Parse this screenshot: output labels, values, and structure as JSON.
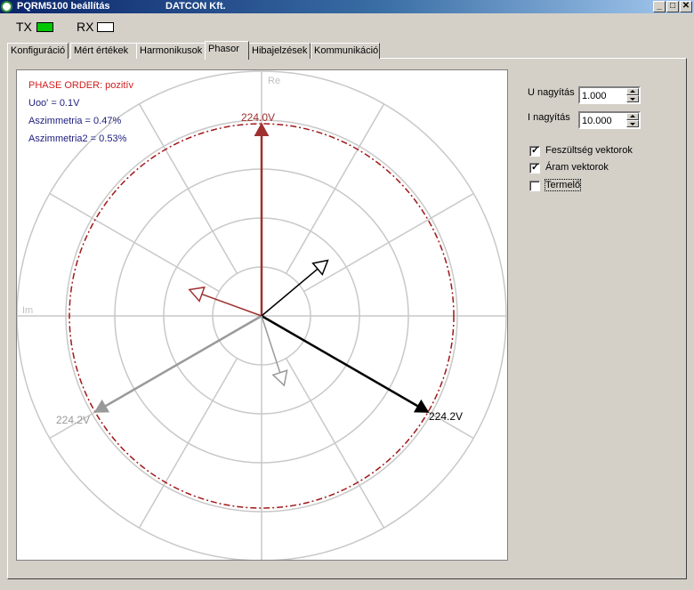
{
  "window": {
    "title": "PQRM5100 beállítás",
    "company": "DATCON Kft.",
    "minimize": "_",
    "maximize": "□",
    "close": "✕"
  },
  "indicators": {
    "tx": {
      "label": "TX",
      "color": "#00c800"
    },
    "rx": {
      "label": "RX",
      "color": "#ffffff"
    }
  },
  "tabs": [
    {
      "label": "Konfiguráció",
      "active": false
    },
    {
      "label": "Mért értékek",
      "active": false
    },
    {
      "label": "Harmonikusok",
      "active": false
    },
    {
      "label": "Phasor",
      "active": true
    },
    {
      "label": "Hibajelzések",
      "active": false
    },
    {
      "label": "Kommunikáció",
      "active": false
    }
  ],
  "phasor": {
    "axis_re": "Re",
    "axis_im": "Im",
    "info": {
      "phase_order": "PHASE ORDER: pozitív",
      "uoo": "Uoo' = 0.1V",
      "asym1": "Aszimmetria = 0.47%",
      "asym2": "Aszimmetria2 = 0.53%"
    },
    "colors": {
      "phase1": "#a03030",
      "phase2": "#000000",
      "phase3": "#999999",
      "info_red": "#d02020",
      "info_blue": "#202080",
      "grid": "#c8c8c8",
      "reference_circle": "#a01818"
    },
    "voltage_labels": {
      "u1": "224.0V",
      "u2": "224.2V",
      "u3": "224.2V"
    },
    "voltage_vectors": [
      {
        "phase": 1,
        "magnitude": 224.0,
        "angle_deg": 90
      },
      {
        "phase": 2,
        "magnitude": 224.2,
        "angle_deg": -30
      },
      {
        "phase": 3,
        "magnitude": 224.2,
        "angle_deg": 210
      }
    ],
    "current_vectors": [
      {
        "phase": 1,
        "relative_magnitude": 0.4,
        "angle_deg": 160
      },
      {
        "phase": 2,
        "relative_magnitude": 0.45,
        "angle_deg": 40
      },
      {
        "phase": 3,
        "relative_magnitude": 0.38,
        "angle_deg": -72
      }
    ]
  },
  "controls": {
    "u_label": "U nagyítás",
    "u_value": "1.000",
    "i_label": "I nagyítás",
    "i_value": "10.000",
    "checkboxes": [
      {
        "label": "Feszültség vektorok",
        "checked": true,
        "mark": "✓"
      },
      {
        "label": "Áram vektorok",
        "checked": true,
        "mark": "✓"
      },
      {
        "label": "Termelő",
        "checked": false,
        "mark": ""
      }
    ]
  }
}
